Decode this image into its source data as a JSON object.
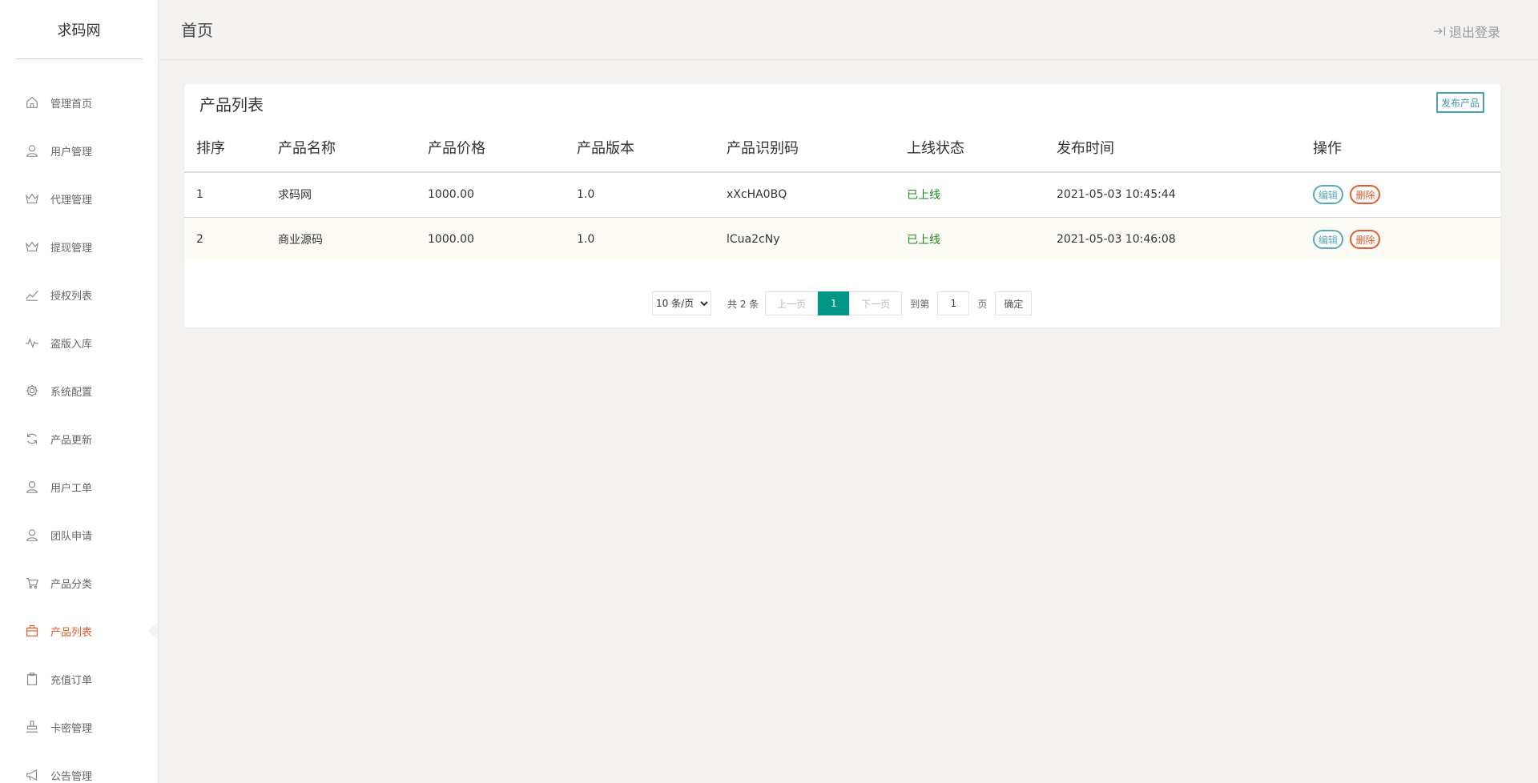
{
  "brand": "求码网",
  "header": {
    "title": "首页",
    "logout": "退出登录"
  },
  "sidebar": {
    "items": [
      {
        "label": "管理首页",
        "icon": "home-icon"
      },
      {
        "label": "用户管理",
        "icon": "user-icon"
      },
      {
        "label": "代理管理",
        "icon": "crown-icon"
      },
      {
        "label": "提现管理",
        "icon": "crown-icon"
      },
      {
        "label": "授权列表",
        "icon": "trend-icon"
      },
      {
        "label": "盗版入库",
        "icon": "pulse-icon"
      },
      {
        "label": "系统配置",
        "icon": "gear-icon"
      },
      {
        "label": "产品更新",
        "icon": "refresh-icon"
      },
      {
        "label": "用户工单",
        "icon": "user-icon"
      },
      {
        "label": "团队申请",
        "icon": "user-icon"
      },
      {
        "label": "产品分类",
        "icon": "cart-icon"
      },
      {
        "label": "产品列表",
        "icon": "bag-icon",
        "active": true
      },
      {
        "label": "充值订单",
        "icon": "clipboard-icon"
      },
      {
        "label": "卡密管理",
        "icon": "stamp-icon"
      },
      {
        "label": "公告管理",
        "icon": "megaphone-icon"
      }
    ]
  },
  "card": {
    "title": "产品列表",
    "publish": "发布产品"
  },
  "table": {
    "headers": [
      "排序",
      "产品名称",
      "产品价格",
      "产品版本",
      "产品识别码",
      "上线状态",
      "发布时间",
      "操作"
    ],
    "rows": [
      {
        "order": "1",
        "name": "求码网",
        "price": "1000.00",
        "version": "1.0",
        "code": "xXcHA0BQ",
        "status": "已上线",
        "time": "2021-05-03 10:45:44"
      },
      {
        "order": "2",
        "name": "商业源码",
        "price": "1000.00",
        "version": "1.0",
        "code": "lCua2cNy",
        "status": "已上线",
        "time": "2021-05-03 10:46:08"
      }
    ],
    "edit": "编辑",
    "delete": "删除"
  },
  "pager": {
    "limit": "10 条/页",
    "total": "共 2 条",
    "prev": "上一页",
    "current": "1",
    "next": "下一页",
    "goto": "到第",
    "page_value": "1",
    "unit": "页",
    "confirm": "确定"
  },
  "colors": {
    "accent": "#e8582c",
    "primary": "#009688",
    "edit": "#58a9bd",
    "online": "#1d8a1d"
  }
}
